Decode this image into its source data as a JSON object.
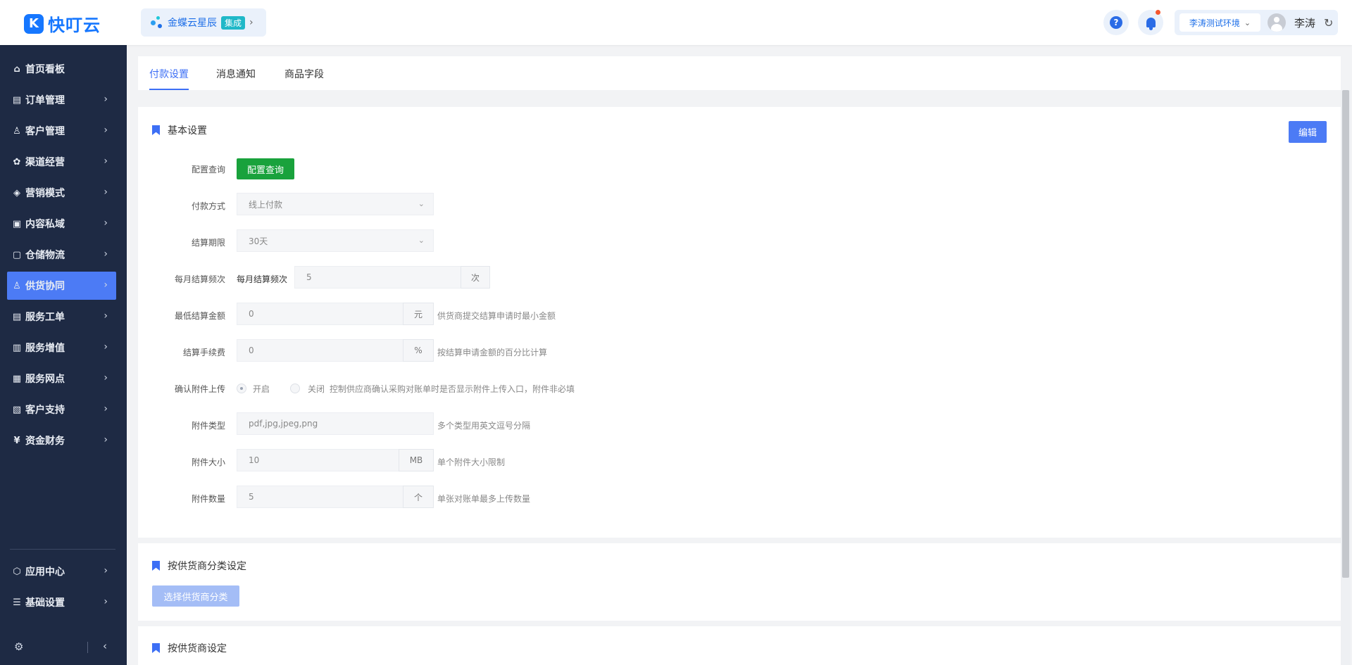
{
  "app": {
    "logo_text": "快叮云",
    "logo_mark": "K"
  },
  "brand": {
    "name": "金蝶云星辰",
    "badge": "集成",
    "chevron": "›"
  },
  "header": {
    "help_glyph": "?",
    "environment": "李涛测试环境",
    "user_name": "李涛",
    "refresh_glyph": "↻",
    "env_chevron": "⌄"
  },
  "sidebar": {
    "items": [
      {
        "label": "首页看板",
        "icon": "⌂",
        "icon_name": "home-icon",
        "has_arrow": false
      },
      {
        "label": "订单管理",
        "icon": "▤",
        "icon_name": "order-icon",
        "has_arrow": true
      },
      {
        "label": "客户管理",
        "icon": "♙",
        "icon_name": "customer-icon",
        "has_arrow": true
      },
      {
        "label": "渠道经营",
        "icon": "✿",
        "icon_name": "channel-icon",
        "has_arrow": true
      },
      {
        "label": "营销模式",
        "icon": "◈",
        "icon_name": "tag-icon",
        "has_arrow": true
      },
      {
        "label": "内容私域",
        "icon": "▣",
        "icon_name": "content-icon",
        "has_arrow": true
      },
      {
        "label": "仓储物流",
        "icon": "▢",
        "icon_name": "warehouse-icon",
        "has_arrow": true
      },
      {
        "label": "供货协同",
        "icon": "♙",
        "icon_name": "supply-icon",
        "has_arrow": true,
        "active": true
      },
      {
        "label": "服务工单",
        "icon": "▤",
        "icon_name": "ticket-icon",
        "has_arrow": true
      },
      {
        "label": "服务增值",
        "icon": "▥",
        "icon_name": "value-added-icon",
        "has_arrow": true
      },
      {
        "label": "服务网点",
        "icon": "▦",
        "icon_name": "store-icon",
        "has_arrow": true
      },
      {
        "label": "客户支持",
        "icon": "▧",
        "icon_name": "support-icon",
        "has_arrow": true
      },
      {
        "label": "资金财务",
        "icon": "¥",
        "icon_name": "finance-icon",
        "has_arrow": true
      }
    ],
    "bottom_items": [
      {
        "label": "应用中心",
        "icon": "⬡",
        "icon_name": "app-center-icon"
      },
      {
        "label": "基础设置",
        "icon": "☰",
        "icon_name": "settings-icon"
      }
    ],
    "arrow": "›",
    "footer_gear": "⚙",
    "footer_collapse": "‹"
  },
  "tabs": [
    {
      "label": "付款设置",
      "active": true
    },
    {
      "label": "消息通知",
      "active": false
    },
    {
      "label": "商品字段",
      "active": false
    }
  ],
  "basic_settings": {
    "title": "基本设置",
    "edit_label": "编辑",
    "config_query_label": "配置查询",
    "config_query_button": "配置查询",
    "payment_method": {
      "label": "付款方式",
      "value": "线上付款"
    },
    "settlement_period": {
      "label": "结算期限",
      "value": "30天"
    },
    "monthly_frequency": {
      "label": "每月结算频次",
      "inline_label": "每月结算频次",
      "value": "5",
      "unit": "次"
    },
    "min_amount": {
      "label": "最低结算金额",
      "value": "0",
      "unit": "元",
      "hint": "供货商提交结算申请时最小金额"
    },
    "fee": {
      "label": "结算手续费",
      "value": "0",
      "unit": "%",
      "hint": "按结算申请金额的百分比计算"
    },
    "attachment_upload": {
      "label": "确认附件上传",
      "on": "开启",
      "off": "关闭",
      "hint": "控制供应商确认采购对账单时是否显示附件上传入口，附件非必填"
    },
    "attachment_type": {
      "label": "附件类型",
      "value": "pdf,jpg,jpeg,png",
      "hint": "多个类型用英文逗号分隔"
    },
    "attachment_size": {
      "label": "附件大小",
      "value": "10",
      "unit": "MB",
      "hint": "单个附件大小限制"
    },
    "attachment_count": {
      "label": "附件数量",
      "value": "5",
      "unit": "个",
      "hint": "单张对账单最多上传数量"
    }
  },
  "category_settings": {
    "title": "按供货商分类设定",
    "button": "选择供货商分类"
  },
  "supplier_settings": {
    "title": "按供货商设定"
  },
  "colors": {
    "primary": "#4c7bf5",
    "sidebar_bg": "#1e2a44",
    "green": "#19a23c",
    "disabled_blue": "#a4bdf6"
  }
}
